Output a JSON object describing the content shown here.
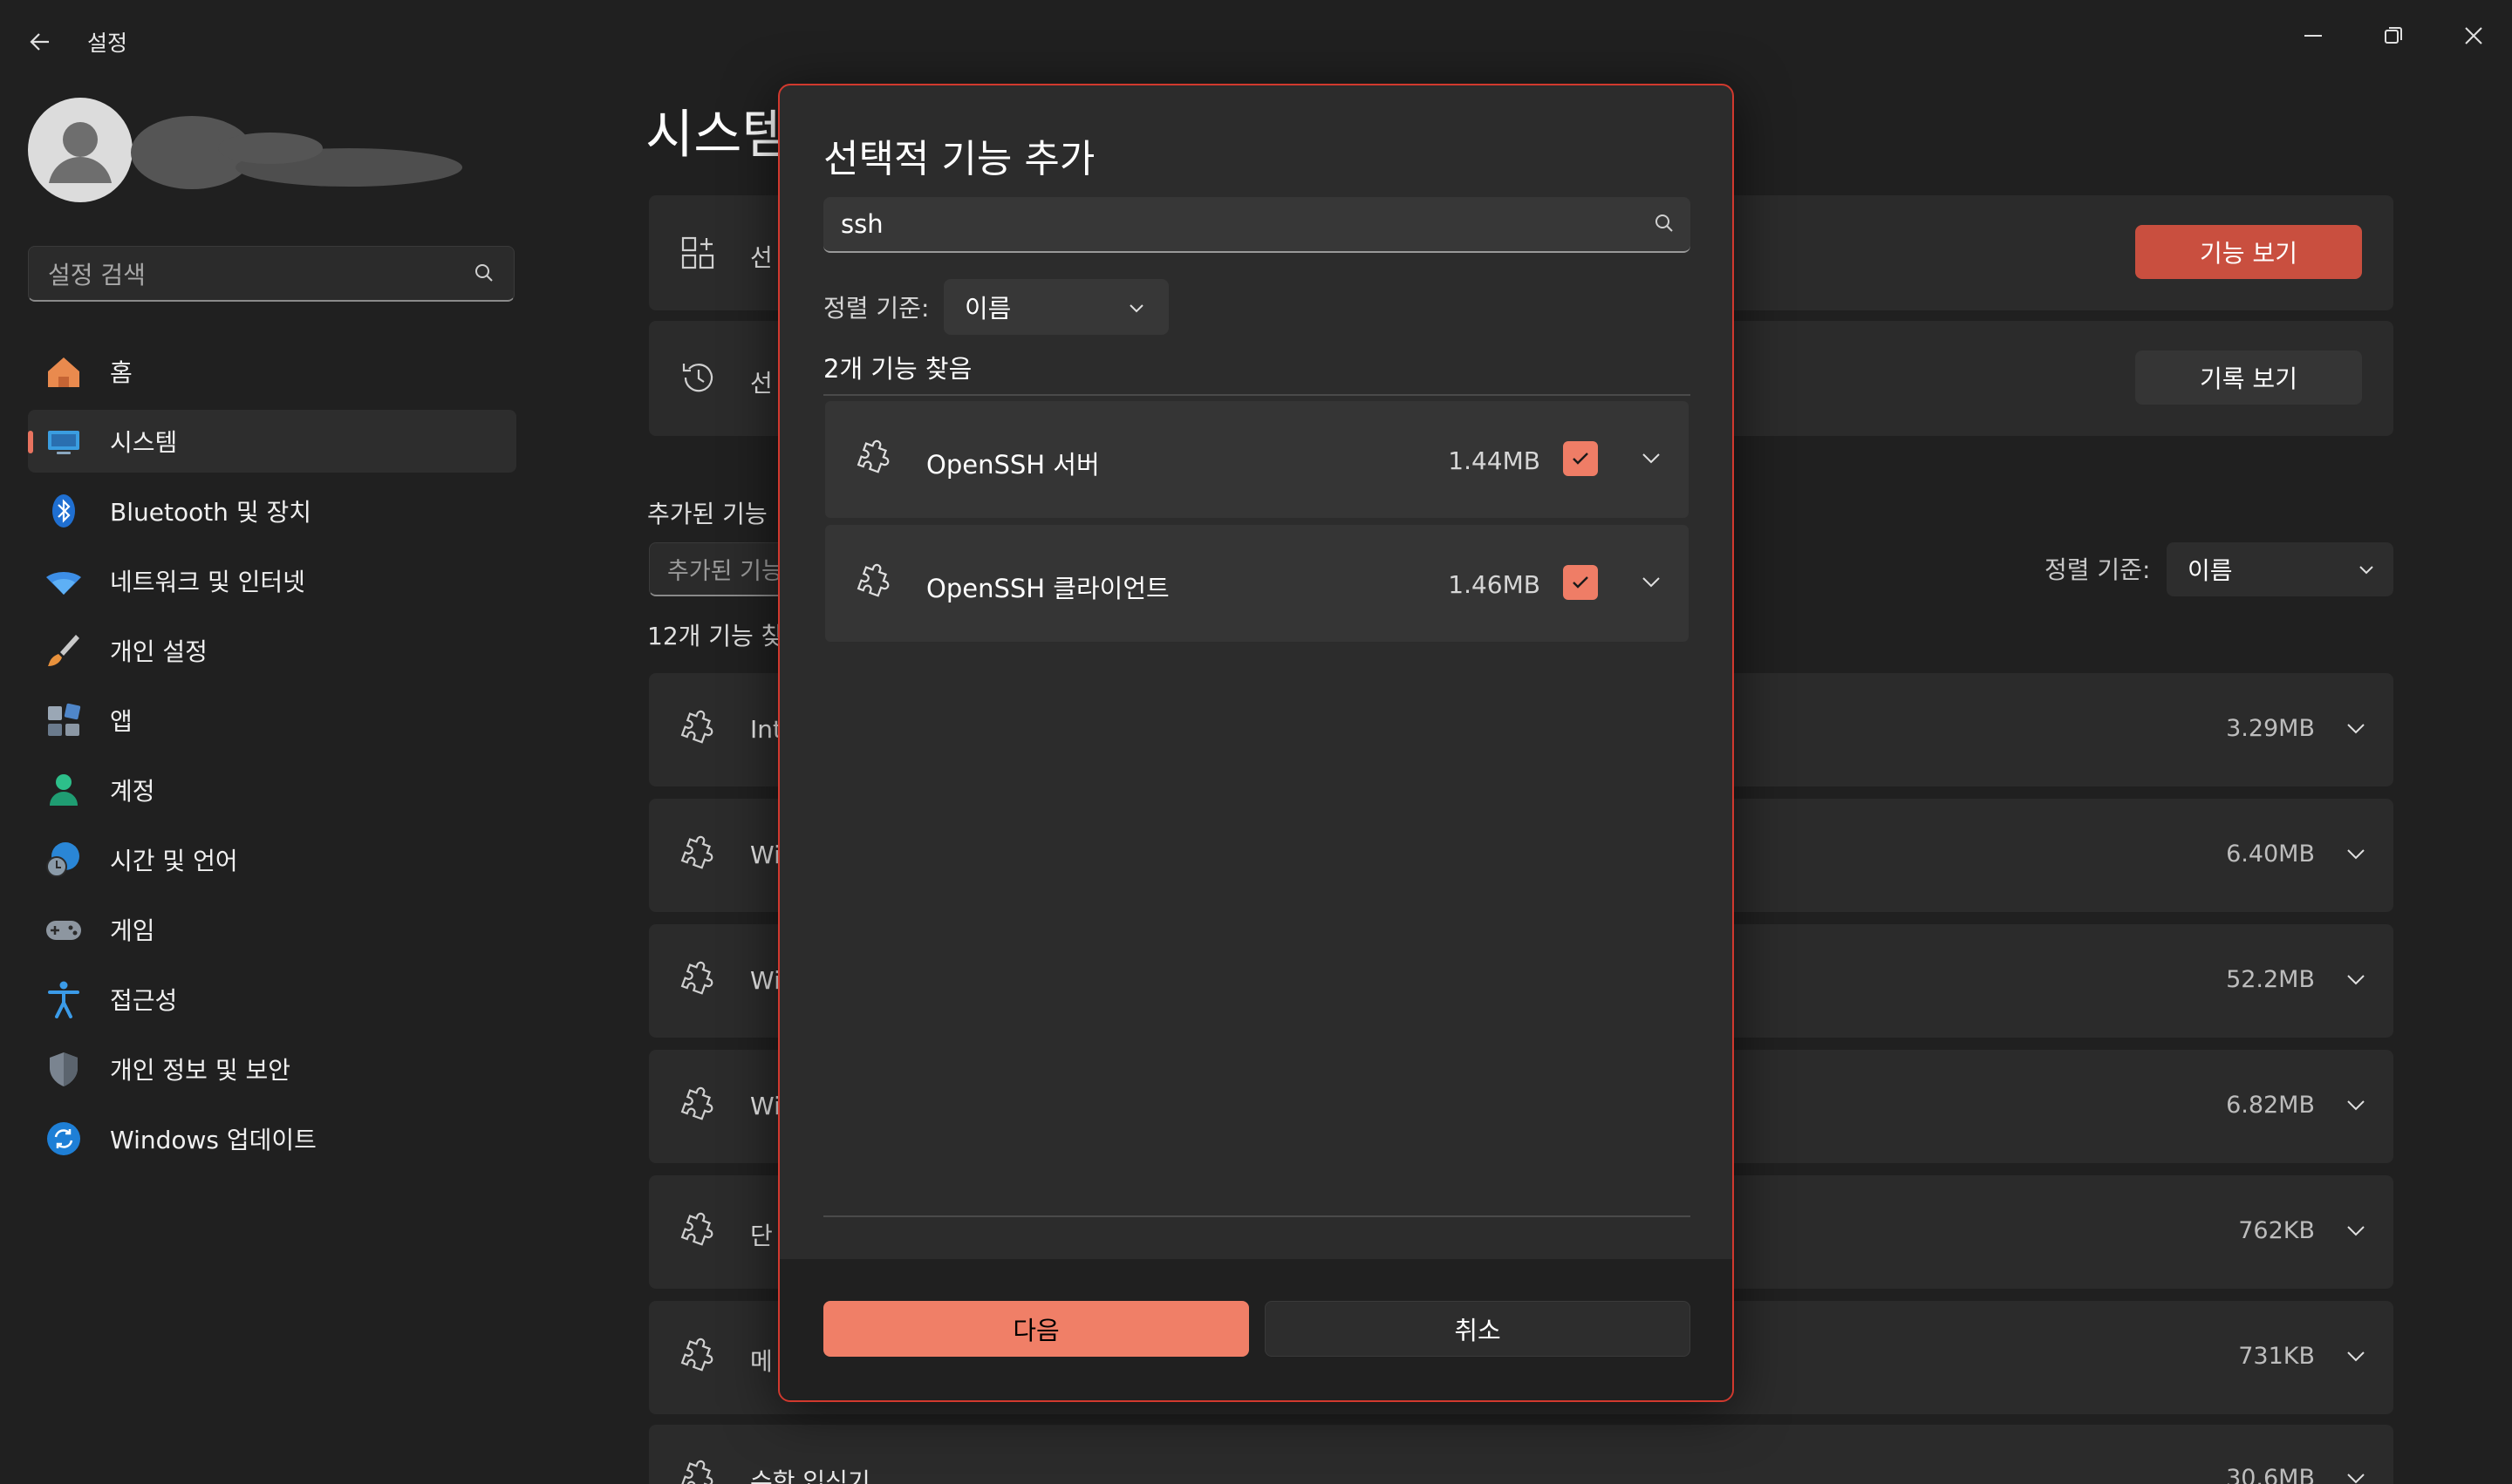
{
  "window": {
    "title": "설정",
    "controls": {
      "minimize": "minimize-icon",
      "maximize": "restore-icon",
      "close": "close-icon"
    }
  },
  "sidebar": {
    "search_placeholder": "설정 검색",
    "items": [
      {
        "label": "홈",
        "icon": "home-icon"
      },
      {
        "label": "시스템",
        "icon": "monitor-icon",
        "active": true
      },
      {
        "label": "Bluetooth 및 장치",
        "icon": "bluetooth-icon"
      },
      {
        "label": "네트워크 및 인터넷",
        "icon": "wifi-icon"
      },
      {
        "label": "개인 설정",
        "icon": "brush-icon"
      },
      {
        "label": "앱",
        "icon": "apps-icon"
      },
      {
        "label": "계정",
        "icon": "person-icon"
      },
      {
        "label": "시간 및 언어",
        "icon": "globe-clock-icon"
      },
      {
        "label": "게임",
        "icon": "gamepad-icon"
      },
      {
        "label": "접근성",
        "icon": "accessibility-icon"
      },
      {
        "label": "개인 정보 및 보안",
        "icon": "shield-icon"
      },
      {
        "label": "Windows 업데이트",
        "icon": "update-icon"
      }
    ]
  },
  "main": {
    "page_title": "시스템",
    "cards": [
      {
        "text": "선",
        "button": "기능 보기",
        "icon": "add-grid-icon"
      },
      {
        "text": "선",
        "button": "기록 보기",
        "icon": "history-icon"
      }
    ],
    "installed_label": "추가된 기능",
    "installed_search_placeholder": "추가된 기능",
    "sort_label": "정렬 기준:",
    "sort_value": "이름",
    "count_text": "12개 기능 찾",
    "features": [
      {
        "name": "Int",
        "size": "3.29MB"
      },
      {
        "name": "Wi",
        "size": "6.40MB"
      },
      {
        "name": "Wi",
        "size": "52.2MB"
      },
      {
        "name": "Wi",
        "size": "6.82MB"
      },
      {
        "name": "단",
        "size": "762KB"
      },
      {
        "name": "메",
        "size": "731KB"
      },
      {
        "name": "수학 입식기",
        "size": "30.6MB"
      }
    ]
  },
  "dialog": {
    "title": "선택적 기능 추가",
    "search_value": "ssh",
    "sort_label": "정렬 기준:",
    "sort_value": "이름",
    "found_text": "2개 기능 찾음",
    "items": [
      {
        "name": "OpenSSH 서버",
        "size": "1.44MB",
        "checked": true
      },
      {
        "name": "OpenSSH 클라이언트",
        "size": "1.46MB",
        "checked": true
      }
    ],
    "next_label": "다음",
    "cancel_label": "취소"
  },
  "colors": {
    "accent": "#f07f67",
    "accent_dark": "#c94f3f",
    "dialog_border": "#d1392e",
    "background": "#202020"
  }
}
